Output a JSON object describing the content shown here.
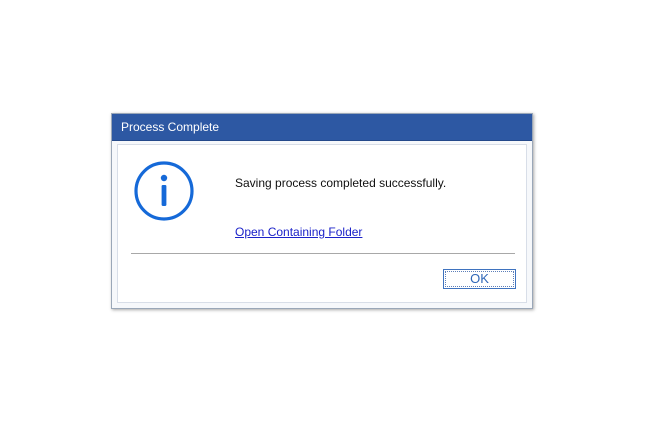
{
  "dialog": {
    "title": "Process Complete",
    "icon": "info-circle-icon",
    "message": "Saving process completed successfully.",
    "link_text": "Open Containing Folder",
    "ok_label": "OK",
    "colors": {
      "titlebar": "#2d58a3",
      "icon": "#1569d8",
      "link": "#1b22c9"
    }
  }
}
